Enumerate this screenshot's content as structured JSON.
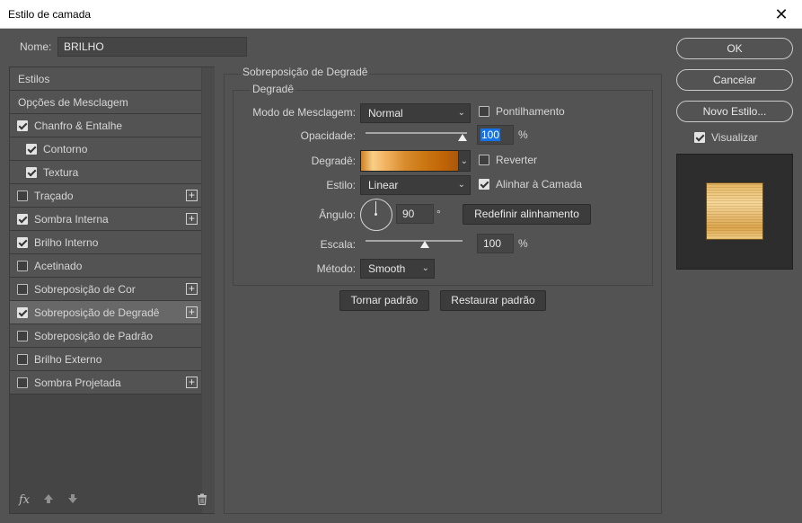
{
  "window": {
    "title": "Estilo de camada",
    "close_glyph": "✕"
  },
  "name_field": {
    "label": "Nome:",
    "value": "BRILHO"
  },
  "sidebar": {
    "items": [
      {
        "label": "Estilos",
        "checkbox": false,
        "checked": false,
        "plus": false
      },
      {
        "label": "Opções de Mesclagem",
        "checkbox": false,
        "checked": false,
        "plus": false
      },
      {
        "label": "Chanfro & Entalhe",
        "checkbox": true,
        "checked": true,
        "plus": false
      },
      {
        "label": "Contorno",
        "checkbox": true,
        "checked": true,
        "plus": false,
        "indent": true
      },
      {
        "label": "Textura",
        "checkbox": true,
        "checked": true,
        "plus": false,
        "indent": true
      },
      {
        "label": "Traçado",
        "checkbox": true,
        "checked": false,
        "plus": true
      },
      {
        "label": "Sombra Interna",
        "checkbox": true,
        "checked": true,
        "plus": true
      },
      {
        "label": "Brilho Interno",
        "checkbox": true,
        "checked": true,
        "plus": false
      },
      {
        "label": "Acetinado",
        "checkbox": true,
        "checked": false,
        "plus": false
      },
      {
        "label": "Sobreposição de Cor",
        "checkbox": true,
        "checked": false,
        "plus": true
      },
      {
        "label": "Sobreposição de Degradê",
        "checkbox": true,
        "checked": true,
        "plus": true,
        "selected": true
      },
      {
        "label": "Sobreposição de Padrão",
        "checkbox": true,
        "checked": false,
        "plus": false
      },
      {
        "label": "Brilho Externo",
        "checkbox": true,
        "checked": false,
        "plus": false
      },
      {
        "label": "Sombra Projetada",
        "checkbox": true,
        "checked": false,
        "plus": true
      }
    ],
    "plus_glyph": "+",
    "footer": {
      "fx_label": "fx",
      "up_icon": "arrow-up-icon",
      "down_icon": "arrow-down-icon",
      "trash_icon": "trash-icon"
    }
  },
  "panel": {
    "section_title": "Sobreposição de Degradê",
    "group_title": "Degradê",
    "blend_mode": {
      "label": "Modo de Mesclagem:",
      "value": "Normal"
    },
    "dither": {
      "label": "Pontilhamento",
      "checked": false
    },
    "opacity": {
      "label": "Opacidade:",
      "value": "100",
      "unit": "%",
      "level": 100
    },
    "gradient": {
      "label": "Degradê:"
    },
    "reverse": {
      "label": "Reverter",
      "checked": false
    },
    "style": {
      "label": "Estilo:",
      "value": "Linear"
    },
    "align_layer": {
      "label": "Alinhar à Camada",
      "checked": true
    },
    "angle": {
      "label": "Ângulo:",
      "value": "90",
      "unit": "°"
    },
    "reset_alignment": "Redefinir alinhamento",
    "scale": {
      "label": "Escala:",
      "value": "100",
      "unit": "%",
      "level": 100
    },
    "method": {
      "label": "Método:",
      "value": "Smooth"
    },
    "make_default": "Tornar padrão",
    "reset_default": "Restaurar padrão"
  },
  "right": {
    "ok": "OK",
    "cancel": "Cancelar",
    "new_style": "Novo Estilo...",
    "preview": {
      "label": "Visualizar",
      "checked": true
    }
  },
  "colors": {
    "dialog_bg": "#535353",
    "field_bg": "#454545",
    "accent": "#1473e6"
  }
}
